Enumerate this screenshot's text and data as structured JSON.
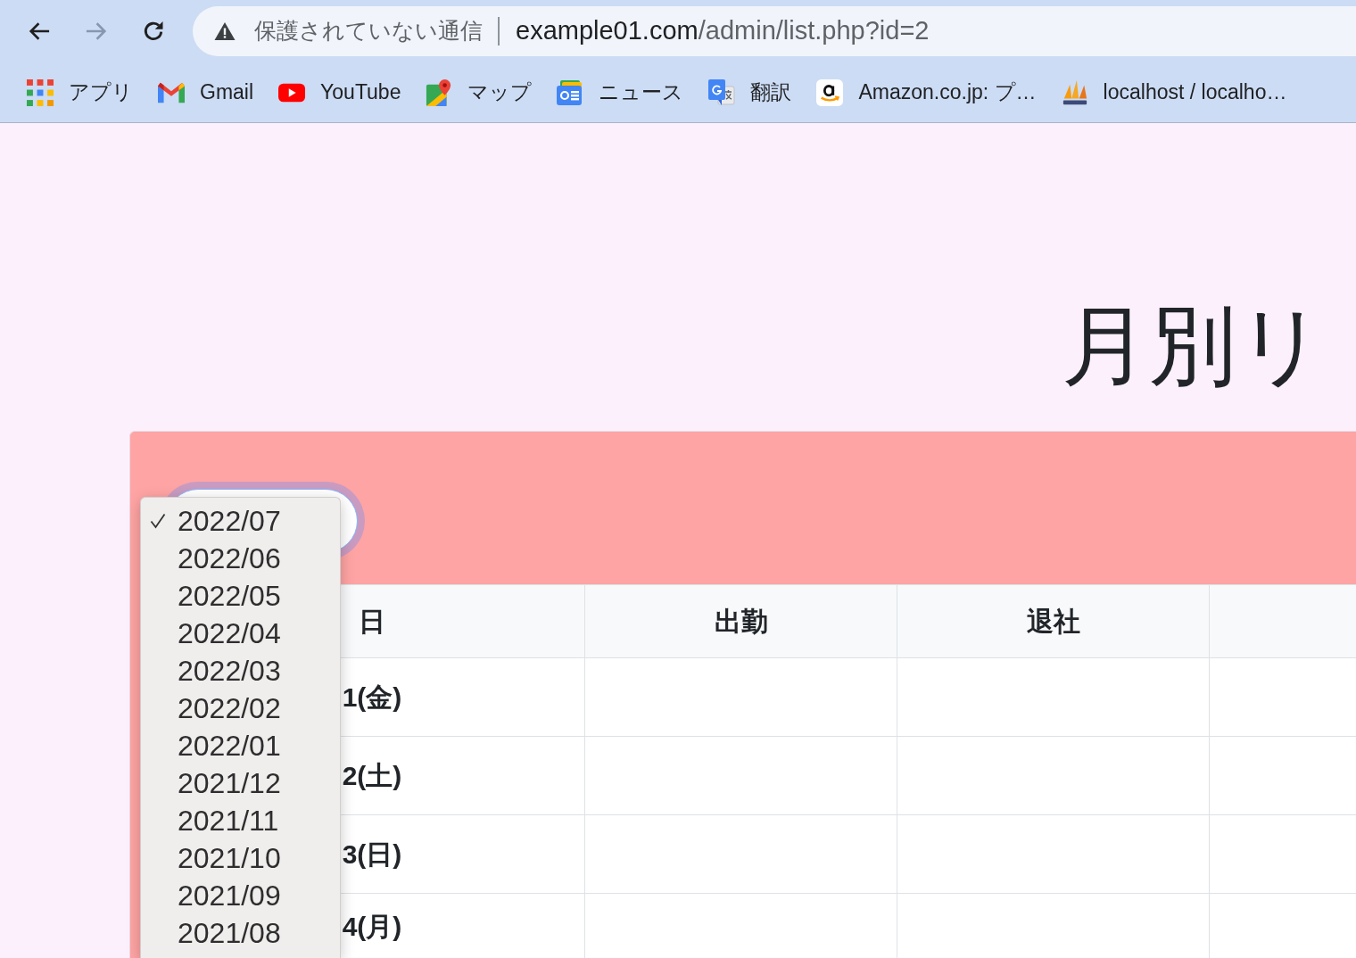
{
  "browser": {
    "nav_buttons": [
      {
        "kind": "back",
        "disabled": false
      },
      {
        "kind": "forward",
        "disabled": true
      },
      {
        "kind": "reload",
        "disabled": false
      }
    ],
    "address_bar": {
      "security_warning": "保護されていない通信",
      "url_host": "example01.com",
      "url_path": "/admin/list.php?id=2"
    },
    "bookmarks": [
      {
        "kind": "apps",
        "label": "アプリ"
      },
      {
        "kind": "gmail",
        "label": "Gmail"
      },
      {
        "kind": "youtube",
        "label": "YouTube"
      },
      {
        "kind": "maps",
        "label": "マップ"
      },
      {
        "kind": "news",
        "label": "ニュース"
      },
      {
        "kind": "translate",
        "label": "翻訳"
      },
      {
        "kind": "amazon",
        "label": "Amazon.co.jp: プ…"
      },
      {
        "kind": "phpmyadmin",
        "label": "localhost / localho…"
      }
    ]
  },
  "page": {
    "title": "月別リ",
    "month_select": {
      "focused": true,
      "options": [
        {
          "label": "2022/07",
          "selected": true
        },
        {
          "label": "2022/06",
          "selected": false
        },
        {
          "label": "2022/05",
          "selected": false
        },
        {
          "label": "2022/04",
          "selected": false
        },
        {
          "label": "2022/03",
          "selected": false
        },
        {
          "label": "2022/02",
          "selected": false
        },
        {
          "label": "2022/01",
          "selected": false
        },
        {
          "label": "2021/12",
          "selected": false
        },
        {
          "label": "2021/11",
          "selected": false
        },
        {
          "label": "2021/10",
          "selected": false
        },
        {
          "label": "2021/09",
          "selected": false
        },
        {
          "label": "2021/08",
          "selected": false
        }
      ]
    },
    "table": {
      "columns": [
        "日",
        "出勤",
        "退社"
      ],
      "rows": [
        {
          "day": "1(金)"
        },
        {
          "day": "2(土)"
        },
        {
          "day": "3(日)"
        },
        {
          "day": "4(月)"
        }
      ]
    }
  }
}
